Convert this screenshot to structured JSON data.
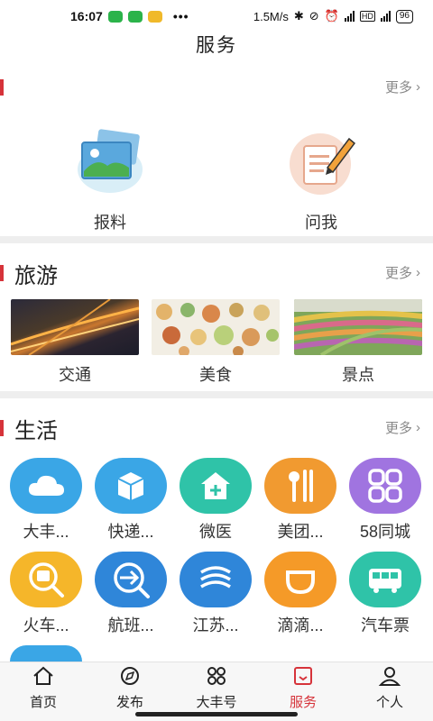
{
  "status_bar": {
    "time": "16:07",
    "dots": "•••",
    "network_speed": "1.5M/s",
    "battery": "96"
  },
  "page": {
    "title": "服务"
  },
  "services": {
    "more_label": "更多",
    "items": [
      {
        "label": "报料",
        "icon": "photo-icon"
      },
      {
        "label": "问我",
        "icon": "note-pencil-icon"
      }
    ]
  },
  "travel": {
    "title": "旅游",
    "more_label": "更多",
    "items": [
      {
        "label": "交通"
      },
      {
        "label": "美食"
      },
      {
        "label": "景点"
      }
    ]
  },
  "life": {
    "title": "生活",
    "more_label": "更多",
    "items": [
      {
        "label": "大丰...",
        "icon": "cloud-icon",
        "color": "#3aa6e6"
      },
      {
        "label": "快递...",
        "icon": "package-icon",
        "color": "#3aa6e6"
      },
      {
        "label": "微医",
        "icon": "clinic-icon",
        "color": "#2fc3a8"
      },
      {
        "label": "美团...",
        "icon": "utensils-icon",
        "color": "#f19a30"
      },
      {
        "label": "58同城",
        "icon": "grid-icon",
        "color": "#a074e0"
      },
      {
        "label": "火车...",
        "icon": "train-search-icon",
        "color": "#f5b62a"
      },
      {
        "label": "航班...",
        "icon": "flight-search-icon",
        "color": "#2f86d9"
      },
      {
        "label": "江苏...",
        "icon": "mobile-logo-icon",
        "color": "#2f86d9"
      },
      {
        "label": "滴滴...",
        "icon": "didi-icon",
        "color": "#f59a28"
      },
      {
        "label": "汽车票",
        "icon": "bus-icon",
        "color": "#2fc3a8"
      }
    ]
  },
  "tabs": [
    {
      "label": "首页",
      "icon": "home-icon",
      "active": false
    },
    {
      "label": "发布",
      "icon": "compass-icon",
      "active": false
    },
    {
      "label": "大丰号",
      "icon": "grid-icon",
      "active": false
    },
    {
      "label": "服务",
      "icon": "service-icon",
      "active": true
    },
    {
      "label": "个人",
      "icon": "person-icon",
      "active": false
    }
  ]
}
